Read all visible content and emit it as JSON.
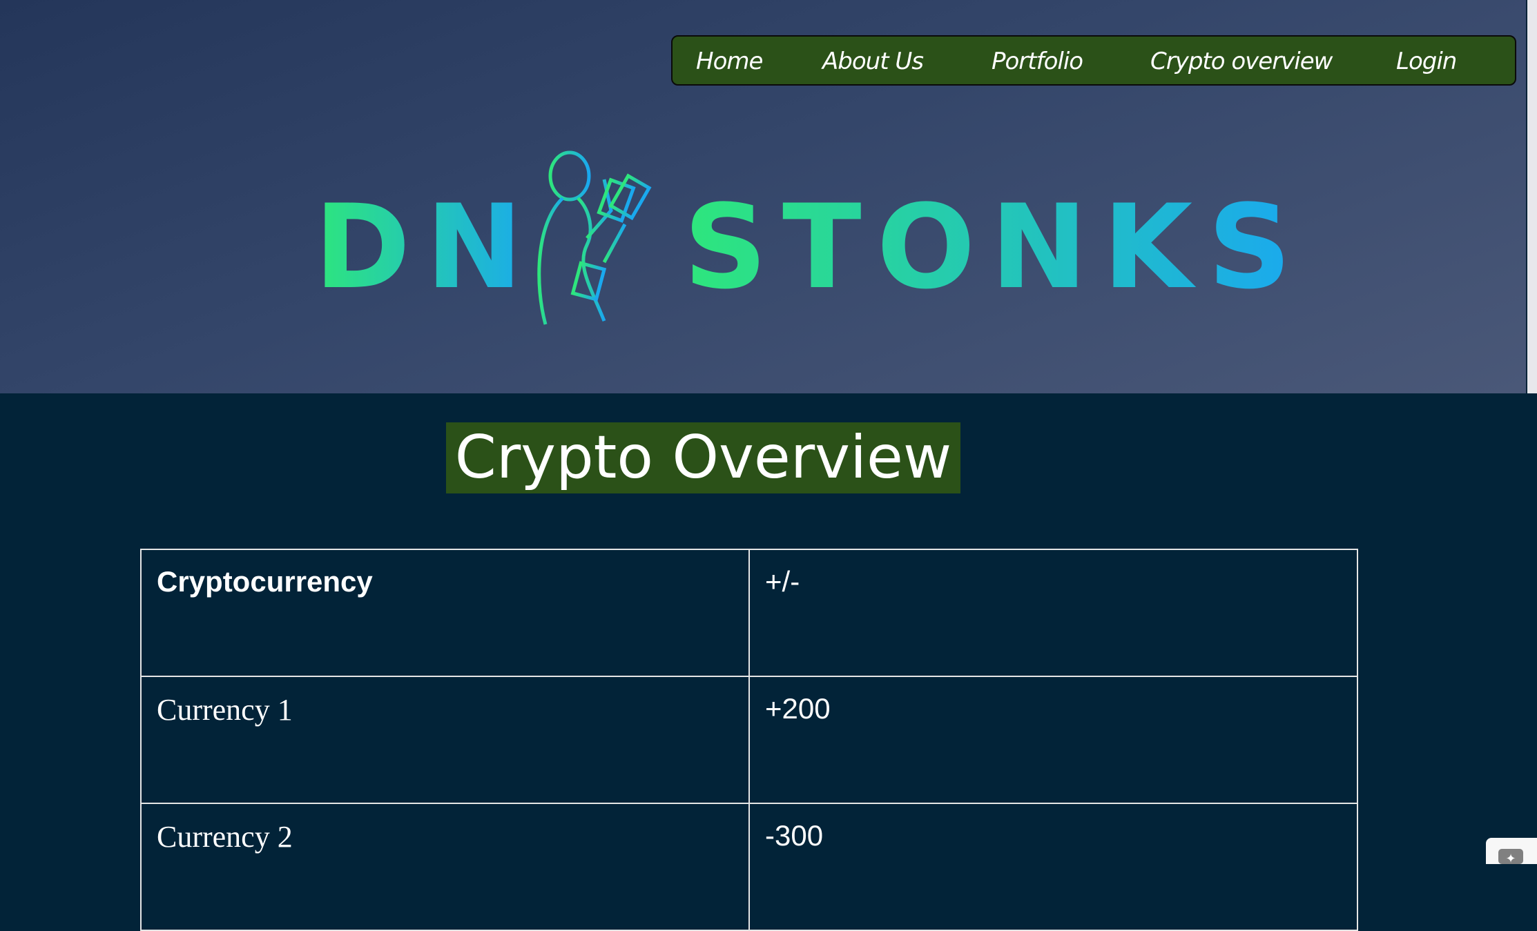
{
  "nav": {
    "items": [
      "Home",
      "About Us",
      "Portfolio",
      "Crypto overview",
      "Login"
    ]
  },
  "logo": {
    "text_left": "DN",
    "text_right": "STONKS"
  },
  "page": {
    "title": "Crypto Overview"
  },
  "table": {
    "headers": [
      "Cryptocurrency",
      "+/-"
    ],
    "rows": [
      [
        "Currency 1",
        "+200"
      ],
      [
        "Currency 2",
        "-300"
      ]
    ]
  },
  "colors": {
    "nav_bg": "#2b5118",
    "body_bg": "#022338",
    "logo_gradient_start": "#2ee67c",
    "logo_gradient_end": "#1aa8f0"
  }
}
